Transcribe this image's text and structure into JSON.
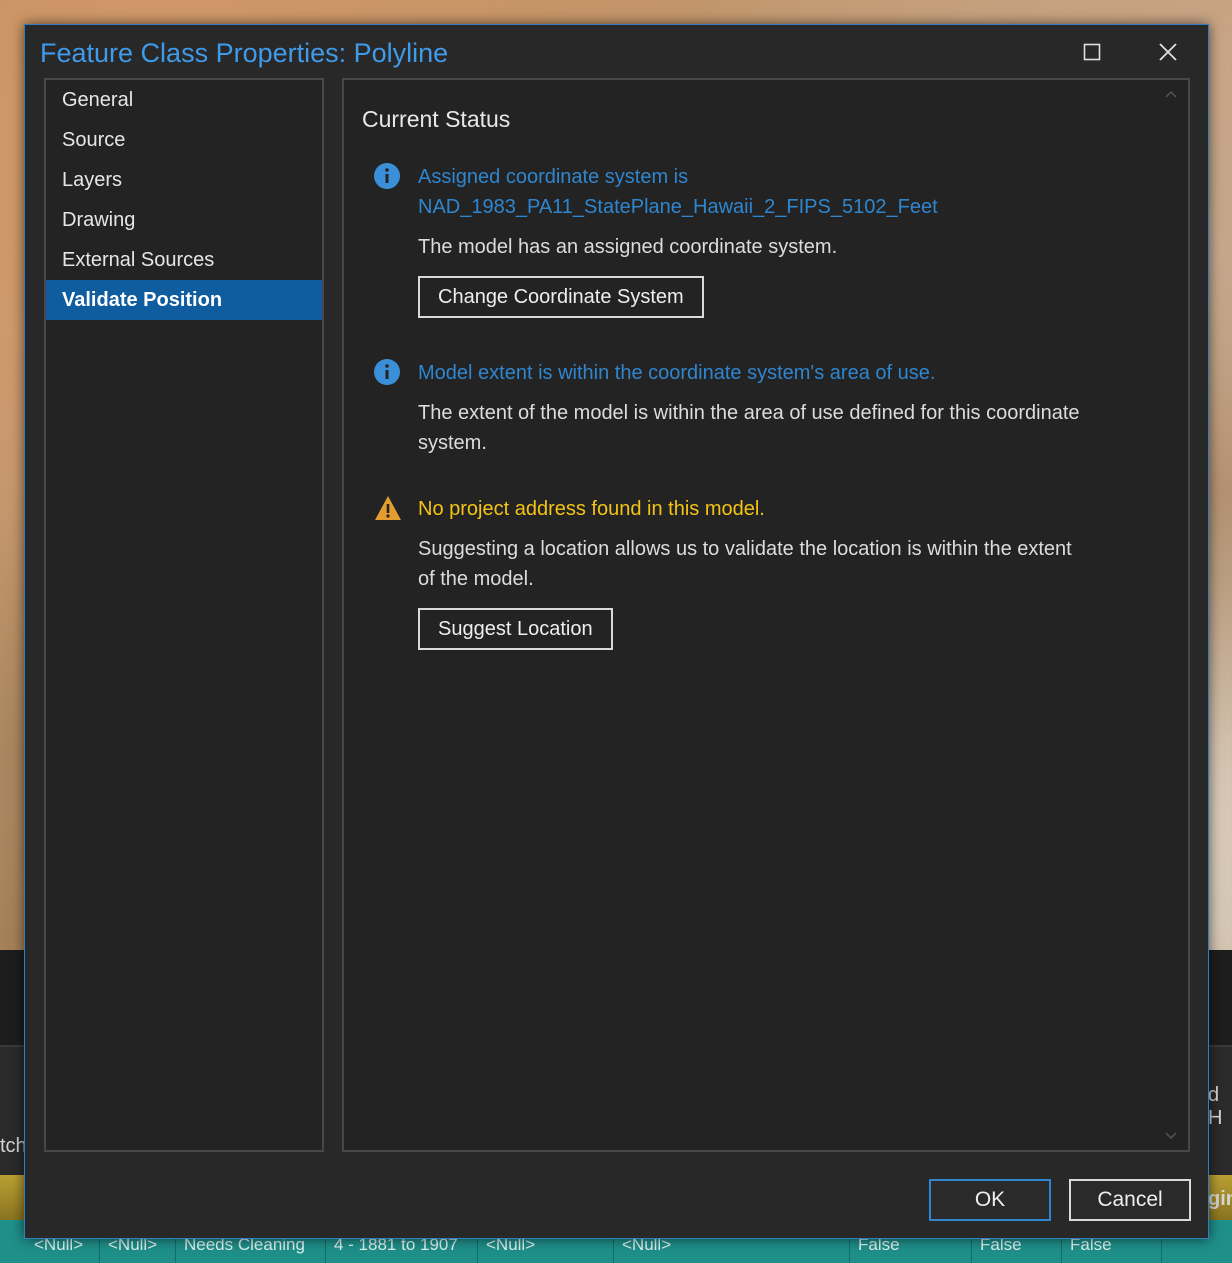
{
  "window": {
    "title": "Feature Class Properties: Polyline",
    "accent_color": "#2f86cf",
    "warning_color": "#f3c316",
    "selected_nav_color": "#0f5c9e"
  },
  "nav": {
    "items": [
      {
        "label": "General",
        "active": false
      },
      {
        "label": "Source",
        "active": false
      },
      {
        "label": "Layers",
        "active": false
      },
      {
        "label": "Drawing",
        "active": false
      },
      {
        "label": "External Sources",
        "active": false
      },
      {
        "label": "Validate Position",
        "active": true
      }
    ]
  },
  "content": {
    "section_title": "Current Status",
    "statuses": [
      {
        "icon": "info-icon",
        "heading_line1": "Assigned coordinate system is",
        "heading_line2": "NAD_1983_PA11_StatePlane_Hawaii_2_FIPS_5102_Feet",
        "text": "The model has an assigned coordinate system.",
        "button_label": "Change Coordinate System"
      },
      {
        "icon": "info-icon",
        "heading": "Model extent is within the coordinate system's area of use.",
        "text_line1": "The extent of the model is within the area of use defined for this coordinate",
        "text_line2": "system."
      },
      {
        "icon": "warning-icon",
        "heading": "No project address found in this model.",
        "text_line1": "Suggesting a location allows us to validate the location is within the extent",
        "text_line2": "of the model.",
        "button_label": "Suggest Location"
      }
    ]
  },
  "footer": {
    "ok_label": "OK",
    "cancel_label": "Cancel"
  },
  "background": {
    "left_partial_text": "tch",
    "right_partial_text_1": "d H",
    "right_partial_text_2": "gin",
    "table_cells": [
      "<Null>",
      "<Null>",
      "Needs Cleaning",
      "4 - 1881 to 1907",
      "<Null>",
      "<Null>",
      "False",
      "False",
      "False"
    ]
  }
}
